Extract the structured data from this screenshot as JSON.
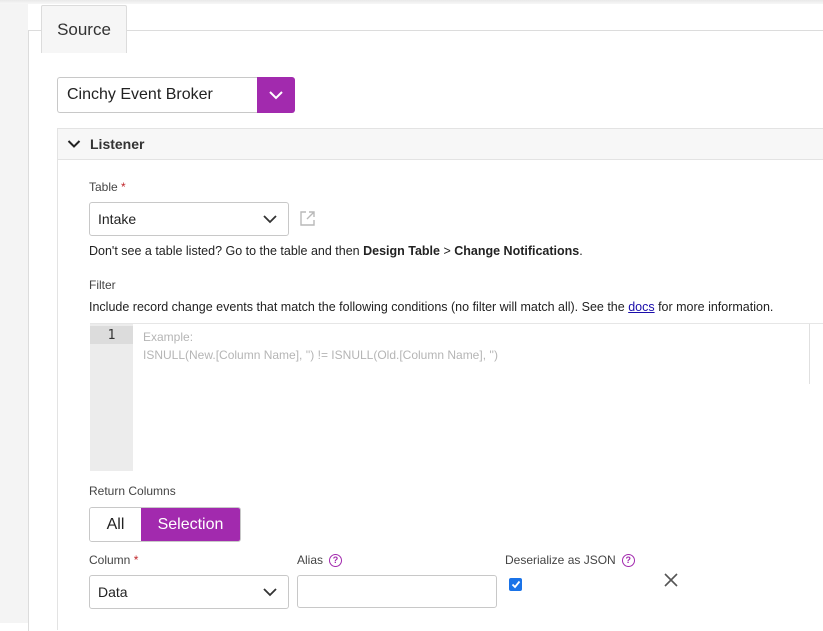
{
  "tabs": {
    "source": "Source"
  },
  "source": {
    "selected": "Cinchy Event Broker"
  },
  "listener": {
    "title": "Listener",
    "table_label": "Table",
    "required_mark": "*",
    "table_value": "Intake",
    "hint_prefix": "Don't see a table listed? Go to the table and then ",
    "hint_design": "Design Table",
    "hint_sep": " > ",
    "hint_change": "Change Notifications",
    "hint_end": ".",
    "filter_label": "Filter",
    "filter_desc_prefix": "Include record change events that match the following conditions (no filter will match all). See the ",
    "filter_link": "docs",
    "filter_desc_suffix": " for more information.",
    "editor": {
      "line_number": "1",
      "placeholder_line1": "Example:",
      "placeholder_line2": "ISNULL(New.[Column Name], '') != ISNULL(Old.[Column Name], '')"
    },
    "return_columns_label": "Return Columns",
    "toggle": {
      "all": "All",
      "selection": "Selection"
    },
    "column_label": "Column",
    "column_value": "Data",
    "alias_label": "Alias",
    "deserialize_label": "Deserialize as JSON",
    "deserialize_checked": true
  },
  "colors": {
    "accent": "#a22aae",
    "checkbox": "#1a73e8"
  },
  "icons": [
    "chevron-down-icon",
    "external-link-icon",
    "help-icon",
    "close-icon",
    "check-icon"
  ]
}
